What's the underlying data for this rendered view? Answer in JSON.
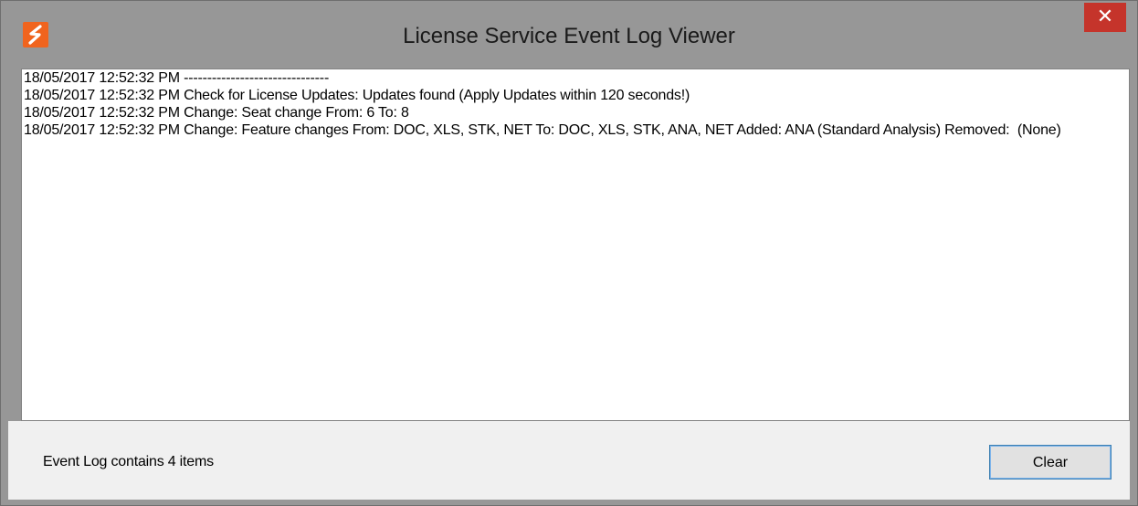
{
  "window": {
    "title": "License Service Event Log Viewer",
    "close_label": "✕",
    "accent_color": "#c5342b",
    "app_icon_color": "#f0641e",
    "app_icon": "s-logo-icon"
  },
  "log": {
    "lines": [
      "18/05/2017 12:52:32 PM -------------------------------",
      "18/05/2017 12:52:32 PM Check for License Updates: Updates found (Apply Updates within 120 seconds!)",
      "18/05/2017 12:52:32 PM Change: Seat change From: 6 To: 8",
      "18/05/2017 12:52:32 PM Change: Feature changes From: DOC, XLS, STK, NET To: DOC, XLS, STK, ANA, NET Added: ANA (Standard Analysis) Removed:  (None)"
    ]
  },
  "footer": {
    "status": "Event Log contains 4 items",
    "clear_label": "Clear"
  }
}
